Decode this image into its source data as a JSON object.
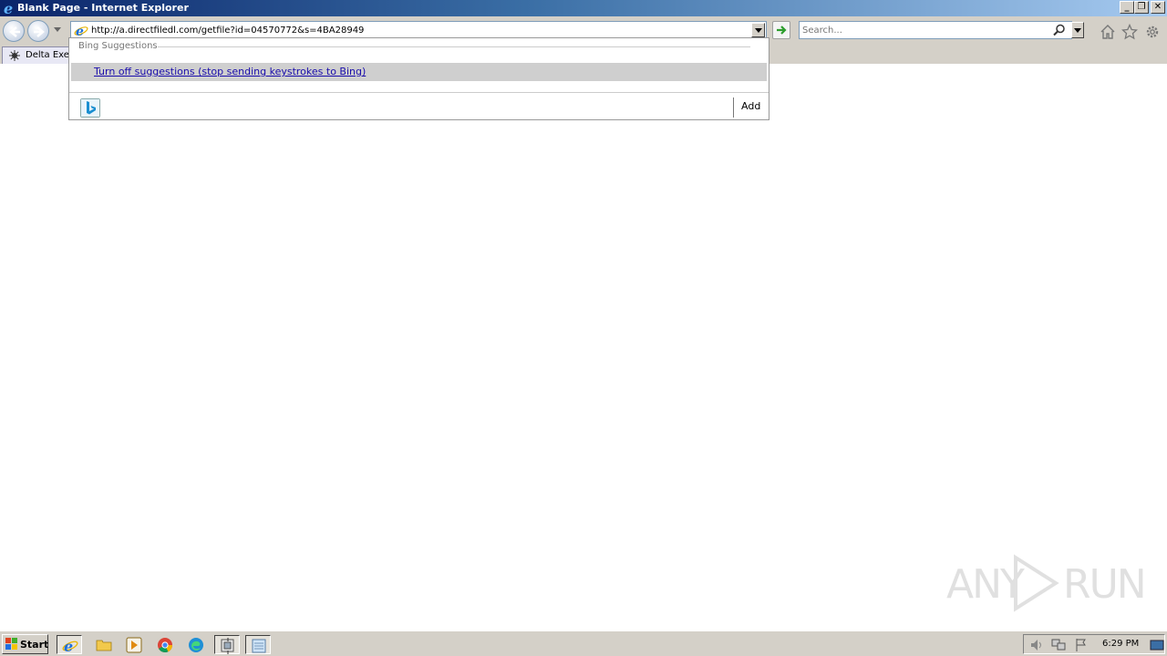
{
  "window": {
    "title": "Blank Page - Internet Explorer",
    "minimize_glyph": "_",
    "restore_glyph": "❐",
    "close_glyph": "✕"
  },
  "navbar": {
    "url": "http://a.directfiledl.com/getfile?id=04570772&s=4BA28949",
    "search_placeholder": "Search..."
  },
  "tabs": [
    {
      "label": "Delta Exec"
    }
  ],
  "suggestions": {
    "heading": "Bing Suggestions",
    "item": "Turn off suggestions (stop sending keystrokes to Bing)",
    "add_label": "Add"
  },
  "watermark": {
    "text_left": "ANY",
    "text_right": "RUN"
  },
  "taskbar": {
    "start_label": "Start",
    "clock": "6:29 PM"
  },
  "colors": {
    "title_gradient_start": "#0a246a",
    "chrome_gray": "#d4d0c8",
    "ie_blue": "#1e6fd9",
    "link_blue": "#1a0dab"
  }
}
